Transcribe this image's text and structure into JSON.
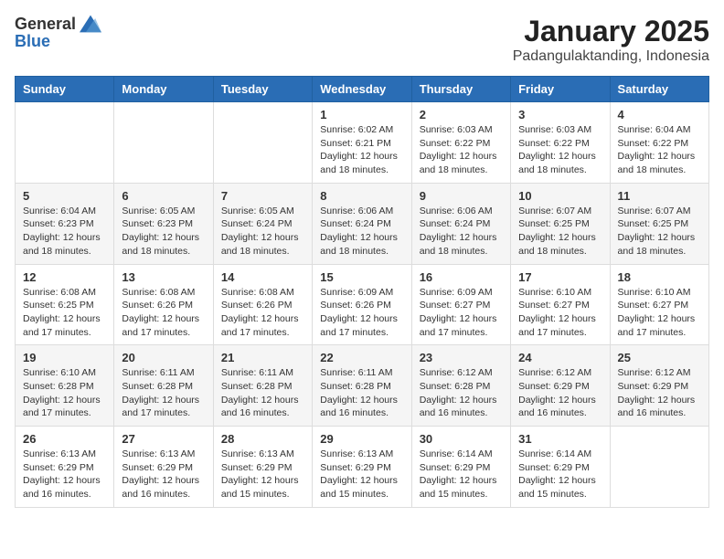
{
  "header": {
    "logo_general": "General",
    "logo_blue": "Blue",
    "title": "January 2025",
    "location": "Padangulaktanding, Indonesia"
  },
  "days_of_week": [
    "Sunday",
    "Monday",
    "Tuesday",
    "Wednesday",
    "Thursday",
    "Friday",
    "Saturday"
  ],
  "weeks": [
    [
      {
        "day": "",
        "info": ""
      },
      {
        "day": "",
        "info": ""
      },
      {
        "day": "",
        "info": ""
      },
      {
        "day": "1",
        "info": "Sunrise: 6:02 AM\nSunset: 6:21 PM\nDaylight: 12 hours\nand 18 minutes."
      },
      {
        "day": "2",
        "info": "Sunrise: 6:03 AM\nSunset: 6:22 PM\nDaylight: 12 hours\nand 18 minutes."
      },
      {
        "day": "3",
        "info": "Sunrise: 6:03 AM\nSunset: 6:22 PM\nDaylight: 12 hours\nand 18 minutes."
      },
      {
        "day": "4",
        "info": "Sunrise: 6:04 AM\nSunset: 6:22 PM\nDaylight: 12 hours\nand 18 minutes."
      }
    ],
    [
      {
        "day": "5",
        "info": "Sunrise: 6:04 AM\nSunset: 6:23 PM\nDaylight: 12 hours\nand 18 minutes."
      },
      {
        "day": "6",
        "info": "Sunrise: 6:05 AM\nSunset: 6:23 PM\nDaylight: 12 hours\nand 18 minutes."
      },
      {
        "day": "7",
        "info": "Sunrise: 6:05 AM\nSunset: 6:24 PM\nDaylight: 12 hours\nand 18 minutes."
      },
      {
        "day": "8",
        "info": "Sunrise: 6:06 AM\nSunset: 6:24 PM\nDaylight: 12 hours\nand 18 minutes."
      },
      {
        "day": "9",
        "info": "Sunrise: 6:06 AM\nSunset: 6:24 PM\nDaylight: 12 hours\nand 18 minutes."
      },
      {
        "day": "10",
        "info": "Sunrise: 6:07 AM\nSunset: 6:25 PM\nDaylight: 12 hours\nand 18 minutes."
      },
      {
        "day": "11",
        "info": "Sunrise: 6:07 AM\nSunset: 6:25 PM\nDaylight: 12 hours\nand 18 minutes."
      }
    ],
    [
      {
        "day": "12",
        "info": "Sunrise: 6:08 AM\nSunset: 6:25 PM\nDaylight: 12 hours\nand 17 minutes."
      },
      {
        "day": "13",
        "info": "Sunrise: 6:08 AM\nSunset: 6:26 PM\nDaylight: 12 hours\nand 17 minutes."
      },
      {
        "day": "14",
        "info": "Sunrise: 6:08 AM\nSunset: 6:26 PM\nDaylight: 12 hours\nand 17 minutes."
      },
      {
        "day": "15",
        "info": "Sunrise: 6:09 AM\nSunset: 6:26 PM\nDaylight: 12 hours\nand 17 minutes."
      },
      {
        "day": "16",
        "info": "Sunrise: 6:09 AM\nSunset: 6:27 PM\nDaylight: 12 hours\nand 17 minutes."
      },
      {
        "day": "17",
        "info": "Sunrise: 6:10 AM\nSunset: 6:27 PM\nDaylight: 12 hours\nand 17 minutes."
      },
      {
        "day": "18",
        "info": "Sunrise: 6:10 AM\nSunset: 6:27 PM\nDaylight: 12 hours\nand 17 minutes."
      }
    ],
    [
      {
        "day": "19",
        "info": "Sunrise: 6:10 AM\nSunset: 6:28 PM\nDaylight: 12 hours\nand 17 minutes."
      },
      {
        "day": "20",
        "info": "Sunrise: 6:11 AM\nSunset: 6:28 PM\nDaylight: 12 hours\nand 17 minutes."
      },
      {
        "day": "21",
        "info": "Sunrise: 6:11 AM\nSunset: 6:28 PM\nDaylight: 12 hours\nand 16 minutes."
      },
      {
        "day": "22",
        "info": "Sunrise: 6:11 AM\nSunset: 6:28 PM\nDaylight: 12 hours\nand 16 minutes."
      },
      {
        "day": "23",
        "info": "Sunrise: 6:12 AM\nSunset: 6:28 PM\nDaylight: 12 hours\nand 16 minutes."
      },
      {
        "day": "24",
        "info": "Sunrise: 6:12 AM\nSunset: 6:29 PM\nDaylight: 12 hours\nand 16 minutes."
      },
      {
        "day": "25",
        "info": "Sunrise: 6:12 AM\nSunset: 6:29 PM\nDaylight: 12 hours\nand 16 minutes."
      }
    ],
    [
      {
        "day": "26",
        "info": "Sunrise: 6:13 AM\nSunset: 6:29 PM\nDaylight: 12 hours\nand 16 minutes."
      },
      {
        "day": "27",
        "info": "Sunrise: 6:13 AM\nSunset: 6:29 PM\nDaylight: 12 hours\nand 16 minutes."
      },
      {
        "day": "28",
        "info": "Sunrise: 6:13 AM\nSunset: 6:29 PM\nDaylight: 12 hours\nand 15 minutes."
      },
      {
        "day": "29",
        "info": "Sunrise: 6:13 AM\nSunset: 6:29 PM\nDaylight: 12 hours\nand 15 minutes."
      },
      {
        "day": "30",
        "info": "Sunrise: 6:14 AM\nSunset: 6:29 PM\nDaylight: 12 hours\nand 15 minutes."
      },
      {
        "day": "31",
        "info": "Sunrise: 6:14 AM\nSunset: 6:29 PM\nDaylight: 12 hours\nand 15 minutes."
      },
      {
        "day": "",
        "info": ""
      }
    ]
  ]
}
